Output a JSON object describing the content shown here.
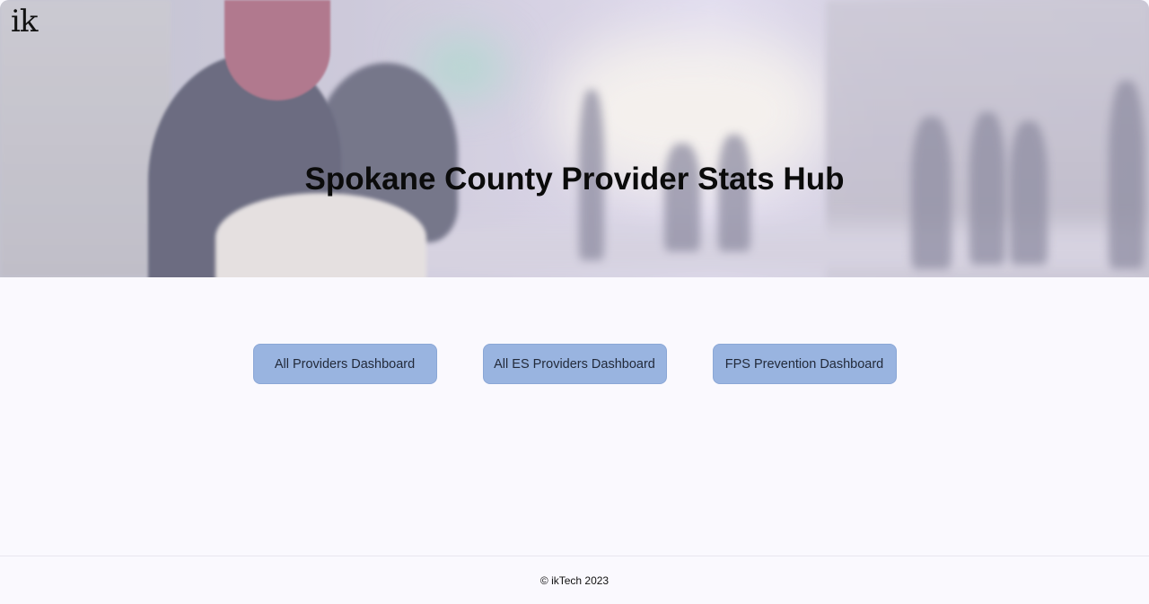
{
  "header": {
    "logo_text": "ik",
    "title": "Spokane County Provider Stats Hub"
  },
  "dashboards": [
    {
      "label": "All Providers Dashboard"
    },
    {
      "label": "All ES Providers Dashboard"
    },
    {
      "label": "FPS Prevention Dashboard"
    }
  ],
  "footer": {
    "copyright": "© ikTech 2023"
  },
  "colors": {
    "button_bg": "#99b4e0",
    "page_bg": "#faf9fe",
    "title_text": "#0b0b0b"
  }
}
